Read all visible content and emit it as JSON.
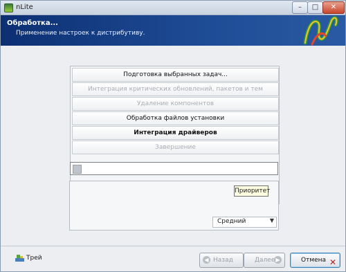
{
  "window": {
    "title": "nLite"
  },
  "titlebar": {
    "min": "–",
    "max": "□",
    "close": "✕"
  },
  "header": {
    "title": "Обработка...",
    "subtitle": "Применение настроек к дистрибутиву."
  },
  "steps": [
    {
      "label": "Подготовка выбранных задач...",
      "state": "done"
    },
    {
      "label": "Интеграция критических обновлений, пакетов и тем",
      "state": "skipped"
    },
    {
      "label": "Удаление компонентов",
      "state": "skipped"
    },
    {
      "label": "Обработка файлов установки",
      "state": "done"
    },
    {
      "label": "Интеграция драйверов",
      "state": "active"
    },
    {
      "label": "Завершение",
      "state": "pending"
    }
  ],
  "progress": {
    "value": 0.03
  },
  "priority": {
    "selected": "Средний",
    "tooltip": "Приоритет"
  },
  "footer": {
    "tray_label": "Трей",
    "back_label": "Назад",
    "next_label": "Далее",
    "cancel_label": "Отмена"
  },
  "icons": {
    "app": "nlite-app-icon",
    "logo": "nlite-logo-icon",
    "tray": "tray-icon",
    "back": "back-arrow-icon",
    "next": "next-arrow-icon",
    "cancel": "cancel-x-icon"
  },
  "colors": {
    "banner": "#1d4a93",
    "accent": "#3c7fb1",
    "tooltip_bg": "#ffffe1"
  }
}
